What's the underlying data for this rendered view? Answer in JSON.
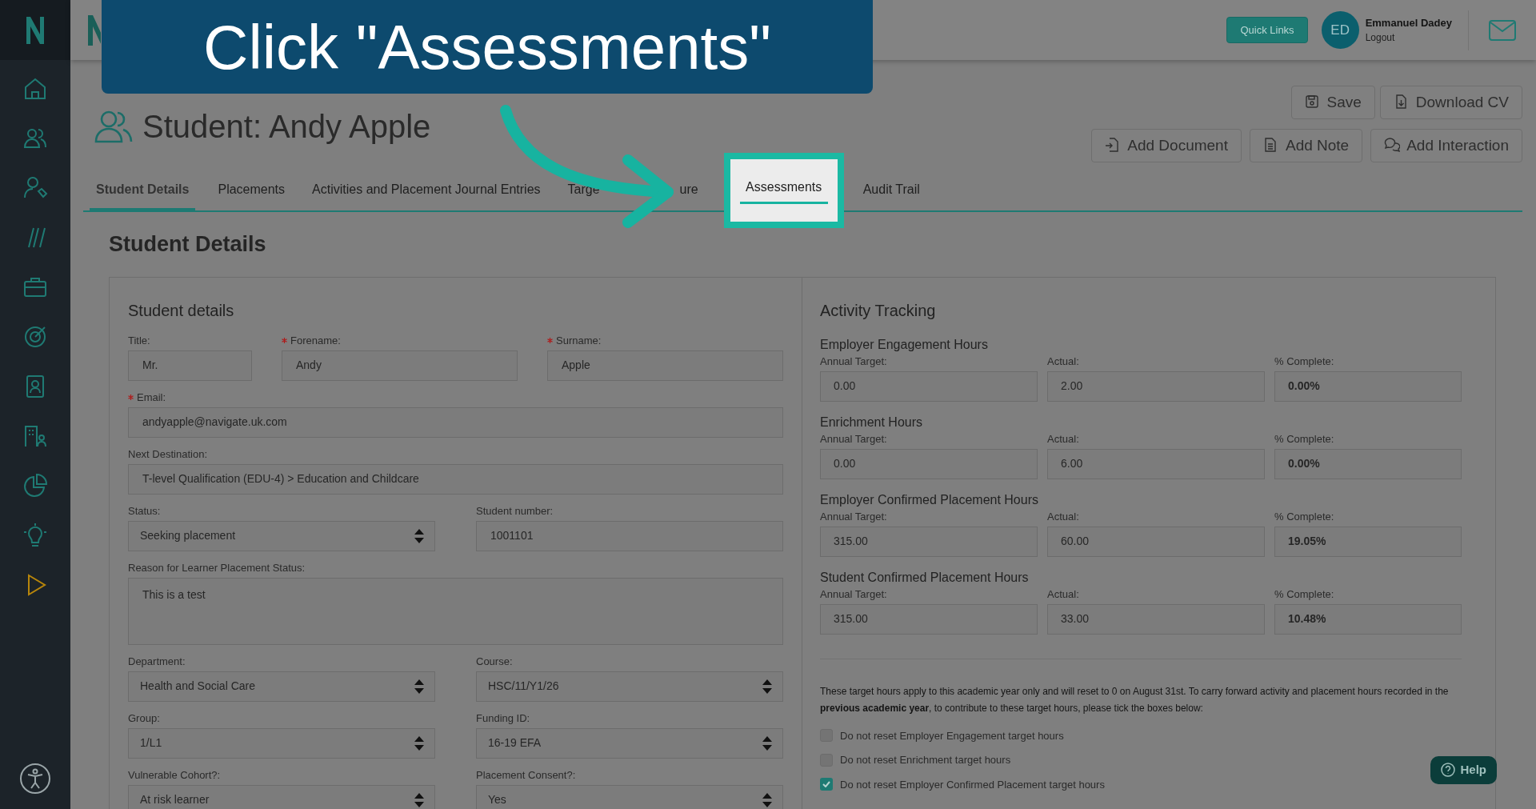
{
  "caption": {
    "text": "Click \"Assessments\""
  },
  "topbar": {
    "quick_links": "Quick Links",
    "user": {
      "initials": "ED",
      "name": "Emmanuel Dadey",
      "logout": "Logout"
    }
  },
  "page_title": "Student: Andy Apple",
  "action_rows": [
    {
      "buttons": [
        {
          "label": "Save",
          "kind": "save"
        },
        {
          "label": "Download CV",
          "kind": "download"
        }
      ]
    },
    {
      "buttons": [
        {
          "label": "Add Document",
          "kind": "document"
        },
        {
          "label": "Add Note",
          "kind": "note"
        },
        {
          "label": "Add Interaction",
          "kind": "interaction"
        }
      ]
    }
  ],
  "tabs": [
    {
      "label": "Student Details",
      "selected": true,
      "spotlight": false
    },
    {
      "label": "Placements",
      "selected": false,
      "spotlight": false
    },
    {
      "label": "Activities and Placement Journal Entries",
      "selected": false,
      "spotlight": false
    },
    {
      "label": "Targe",
      "selected": false,
      "spotlight": false
    },
    {
      "label": "ure",
      "selected": false,
      "spotlight": false
    },
    {
      "label": "Assessments",
      "selected": false,
      "spotlight": true
    },
    {
      "label": "Audit Trail",
      "selected": false,
      "spotlight": false
    }
  ],
  "section_title": "Student Details",
  "student_details": {
    "title": "Student details",
    "rows": [
      {
        "fields": [
          {
            "label": "Title:",
            "required": false,
            "kind": "text",
            "value": "Mr."
          },
          {
            "label": "Forename:",
            "required": true,
            "kind": "text",
            "value": "Andy"
          },
          {
            "label": "Surname:",
            "required": true,
            "kind": "text",
            "value": "Apple"
          }
        ]
      },
      {
        "fields": [
          {
            "label": "Email:",
            "required": true,
            "kind": "text",
            "value": "andyapple@navigate.uk.com"
          }
        ]
      },
      {
        "fields": [
          {
            "label": "Next Destination:",
            "required": false,
            "kind": "text",
            "value": "T-level Qualification (EDU-4) > Education and Childcare"
          }
        ]
      },
      {
        "fields": [
          {
            "label": "Status:",
            "required": false,
            "kind": "select",
            "value": "Seeking placement"
          },
          {
            "label": "Student number:",
            "required": false,
            "kind": "text",
            "value": "1001101"
          }
        ]
      },
      {
        "fields": [
          {
            "label": "Reason for Learner Placement Status:",
            "required": false,
            "kind": "textarea",
            "value": "This is a test"
          }
        ]
      },
      {
        "fields": [
          {
            "label": "Department:",
            "required": false,
            "kind": "select",
            "value": "Health and Social Care"
          },
          {
            "label": "Course:",
            "required": false,
            "kind": "select",
            "value": "HSC/11/Y1/26"
          }
        ]
      },
      {
        "fields": [
          {
            "label": "Group:",
            "required": false,
            "kind": "select",
            "value": "1/L1"
          },
          {
            "label": "Funding ID:",
            "required": false,
            "kind": "select",
            "value": "16-19 EFA"
          }
        ]
      },
      {
        "fields": [
          {
            "label": "Vulnerable Cohort?:",
            "required": false,
            "kind": "select",
            "value": "At risk learner"
          },
          {
            "label": "Placement Consent?:",
            "required": false,
            "kind": "select",
            "value": "Yes"
          }
        ]
      }
    ]
  },
  "activity_tracking": {
    "title": "Activity Tracking",
    "groups": [
      {
        "title": "Employer Engagement Hours",
        "target_label": "Annual Target:",
        "target": "0.00",
        "actual_label": "Actual:",
        "actual": "2.00",
        "complete_label": "% Complete:",
        "complete": "0.00%"
      },
      {
        "title": "Enrichment Hours",
        "target_label": "Annual Target:",
        "target": "0.00",
        "actual_label": "Actual:",
        "actual": "6.00",
        "complete_label": "% Complete:",
        "complete": "0.00%"
      },
      {
        "title": "Employer Confirmed Placement Hours",
        "target_label": "Annual Target:",
        "target": "315.00",
        "actual_label": "Actual:",
        "actual": "60.00",
        "complete_label": "% Complete:",
        "complete": "19.05%"
      },
      {
        "title": "Student Confirmed Placement Hours",
        "target_label": "Annual Target:",
        "target": "315.00",
        "actual_label": "Actual:",
        "actual": "33.00",
        "complete_label": "% Complete:",
        "complete": "10.48%"
      }
    ],
    "note": "These target hours apply to this academic year only and will reset to 0 on August 31st. To carry forward activity and placement hours recorded in the **previous academic year**, to contribute to these target hours, please tick the boxes below:",
    "checkboxes": [
      {
        "label": "Do not reset Employer Engagement target hours",
        "checked": false
      },
      {
        "label": "Do not reset Enrichment target hours",
        "checked": false
      },
      {
        "label": "Do not reset Employer Confirmed Placement target hours",
        "checked": true
      }
    ]
  },
  "help": "Help"
}
